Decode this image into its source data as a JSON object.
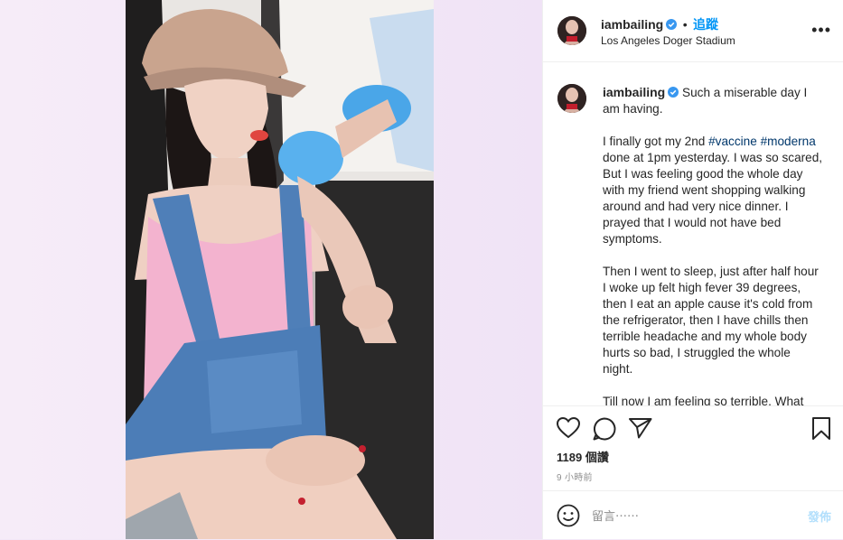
{
  "header": {
    "username": "iambailing",
    "separator": "•",
    "follow_label": "追蹤",
    "location": "Los Angeles Doger Stadium",
    "more_label": "•••"
  },
  "caption": {
    "username": "iambailing",
    "intro": "Such a miserable day I am having.",
    "p2_before": "I finally got my 2nd ",
    "tag1": "#vaccine",
    "tag2": "#moderna",
    "p2_after": " done at 1pm yesterday. I was so scared, But I was feeling good the whole day with my friend went shopping walking around and had very nice dinner. I prayed that I would not have bed symptoms.",
    "p3": "Then I went to sleep, just after half hour I woke up felt high fever 39 degrees, then I eat an apple cause it's cold from the refrigerator, then I have chills then terrible headache and my whole body hurts so bad, I struggled the whole night.",
    "p4": "Till now I am feeling so terrible. What"
  },
  "stats": {
    "views": "1189 個讚",
    "time_ago": "9 小時前"
  },
  "comment": {
    "placeholder": "留言⋯⋯",
    "post_label": "發佈"
  },
  "icons": {
    "like": "heart-icon",
    "comment": "speech-bubble-icon",
    "share": "paper-plane-icon",
    "save": "bookmark-icon",
    "emoji": "smiley-icon",
    "verified": "verified-badge-icon"
  },
  "colors": {
    "link": "#0095f6",
    "hashtag": "#00376b",
    "verified": "#3897f0",
    "post_disabled": "#b2dffc"
  }
}
